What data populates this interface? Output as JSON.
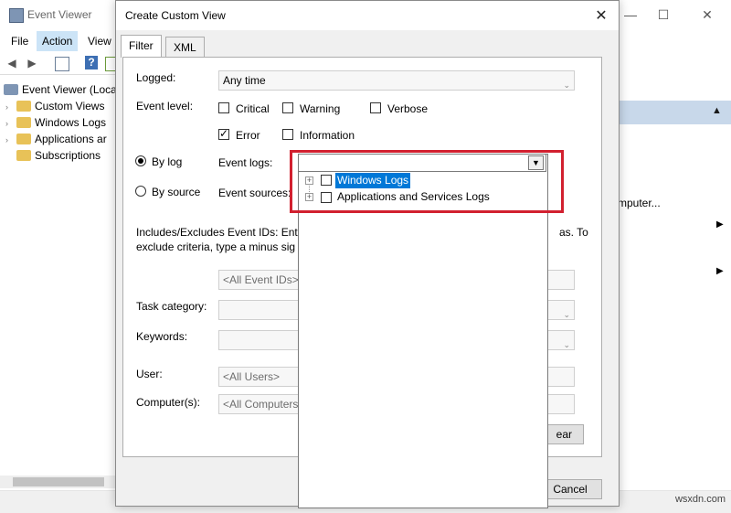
{
  "background_window": {
    "title": "Event Viewer",
    "menu": [
      "File",
      "Action",
      "View"
    ],
    "tree": [
      {
        "label": "Event Viewer (Loca"
      },
      {
        "label": "Custom Views"
      },
      {
        "label": "Windows Logs"
      },
      {
        "label": "Applications ar"
      },
      {
        "label": "Subscriptions"
      }
    ],
    "right_pane_text": "mputer..."
  },
  "dialog": {
    "title": "Create Custom View",
    "tabs": [
      "Filter",
      "XML"
    ],
    "logged_label": "Logged:",
    "logged_value": "Any time",
    "event_level_label": "Event level:",
    "levels": [
      {
        "label": "Critical",
        "checked": false
      },
      {
        "label": "Warning",
        "checked": false
      },
      {
        "label": "Verbose",
        "checked": false
      },
      {
        "label": "Error",
        "checked": true
      },
      {
        "label": "Information",
        "checked": false
      }
    ],
    "by_log_label": "By log",
    "by_source_label": "By source",
    "event_logs_label": "Event logs:",
    "event_sources_label": "Event sources:",
    "includes_text_1": "Includes/Excludes Event IDs: Ente",
    "includes_text_1b": "as. To",
    "includes_text_2": "exclude criteria, type a minus sig",
    "event_ids_placeholder": "<All Event IDs>",
    "task_category_label": "Task category:",
    "keywords_label": "Keywords:",
    "user_label": "User:",
    "user_placeholder": "<All Users>",
    "computers_label": "Computer(s):",
    "computers_placeholder": "<All Computers>",
    "clear_button": "ear",
    "cancel_button": "Cancel"
  },
  "dropdown": {
    "items": [
      {
        "label": "Windows Logs",
        "selected": true
      },
      {
        "label": "Applications and Services Logs",
        "selected": false
      }
    ]
  },
  "watermark": "wsxdn.com",
  "colors": {
    "highlight": "#0078d7",
    "annotation": "#d2202f"
  }
}
